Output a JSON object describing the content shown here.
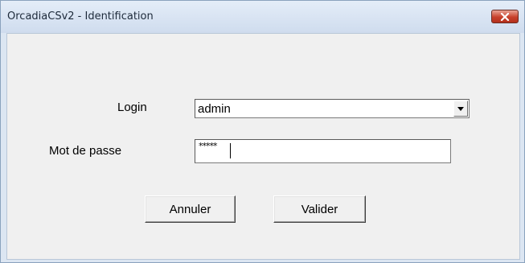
{
  "window": {
    "title": "OrcadiaCSv2 - Identification",
    "close_icon": "close-icon"
  },
  "form": {
    "login_label": "Login",
    "login_value": "admin",
    "password_label": "Mot de passe",
    "password_mask": "*****"
  },
  "buttons": {
    "cancel_label": "Annuler",
    "submit_label": "Valider"
  },
  "colors": {
    "frame": "#dce6f2",
    "client": "#f0f0f0",
    "close_button": "#c8412c"
  }
}
